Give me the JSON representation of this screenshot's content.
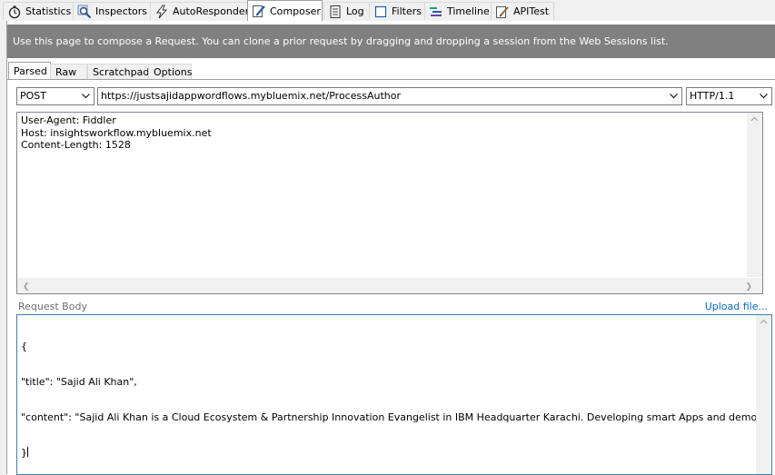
{
  "top_tabs": [
    {
      "label": "Statistics",
      "icon": "stopwatch-icon"
    },
    {
      "label": "Inspectors",
      "icon": "magnifier-icon"
    },
    {
      "label": "AutoResponder",
      "icon": "lightning-icon"
    },
    {
      "label": "Composer",
      "icon": "pencil-icon",
      "active": true
    },
    {
      "label": "Log",
      "icon": "document-icon"
    },
    {
      "label": "Filters",
      "icon": "checkbox-icon"
    },
    {
      "label": "Timeline",
      "icon": "timeline-icon"
    },
    {
      "label": "APITest",
      "icon": "edit-document-icon"
    }
  ],
  "banner": "Use this page to compose a Request. You can clone a prior request by dragging and dropping a session from the Web Sessions list.",
  "sub_tabs": [
    {
      "label": "Parsed",
      "active": true
    },
    {
      "label": "Raw"
    },
    {
      "label": "Scratchpad"
    },
    {
      "label": "Options"
    }
  ],
  "request": {
    "method": "POST",
    "url": "https://justsajidappwordflows.mybluemix.net/ProcessAuthor",
    "version": "HTTP/1.1"
  },
  "headers": [
    "User-Agent: Fiddler",
    "Host: insightsworkflow.mybluemix.net",
    "Content-Length: 1528"
  ],
  "request_body_label": "Request Body",
  "upload_link": "Upload file...",
  "body_lines": [
    "{",
    "\"title\": \"Sajid Ali Khan\",",
    "\"content\": \"Sajid Ali Khan is a Cloud Ecosystem & Partnership Innovation Evangelist in IBM Headquarter Karachi. Developing smart Apps and demos for IBM Bluemix Platf",
    "}"
  ],
  "colors": {
    "banner_bg": "#808080",
    "link": "#0066cc",
    "focus_border": "#3c7fb1"
  }
}
